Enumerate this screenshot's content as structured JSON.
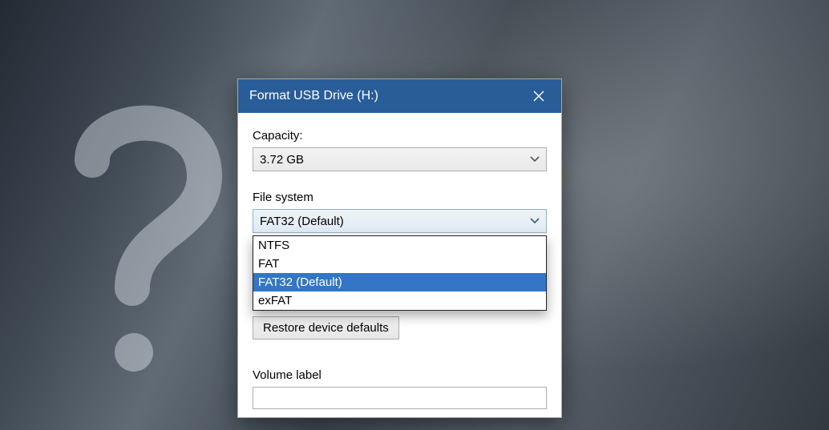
{
  "dialog": {
    "title": "Format USB Drive (H:)",
    "capacity_label": "Capacity:",
    "capacity_value": "3.72 GB",
    "filesystem_label": "File system",
    "filesystem_value": "FAT32 (Default)",
    "filesystem_options": [
      "NTFS",
      "FAT",
      "FAT32 (Default)",
      "exFAT"
    ],
    "filesystem_selected_index": 2,
    "restore_defaults_label": "Restore device defaults",
    "volume_label_label": "Volume label",
    "volume_label_value": ""
  },
  "colors": {
    "titlebar_bg": "#0b62c4",
    "selection_bg": "#0a7cff"
  }
}
